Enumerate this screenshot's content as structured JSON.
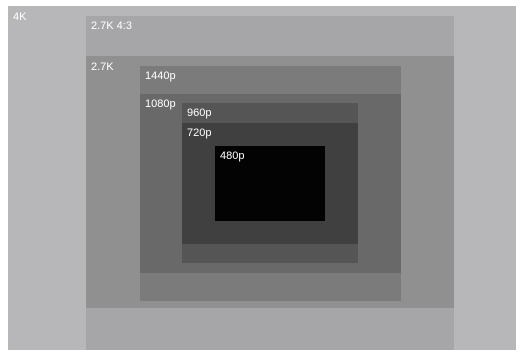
{
  "resolutions": [
    {
      "id": "4k",
      "label": "4K",
      "color": "#b7b7b9"
    },
    {
      "id": "2-7k-43",
      "label": "2.7K 4:3",
      "color": "#a6a6a8"
    },
    {
      "id": "2-7k",
      "label": "2.7K",
      "color": "#909091"
    },
    {
      "id": "1440p",
      "label": "1440p",
      "color": "#7b7b7c"
    },
    {
      "id": "1080p",
      "label": "1080p",
      "color": "#69696a"
    },
    {
      "id": "960p",
      "label": "960p",
      "color": "#555556"
    },
    {
      "id": "720p",
      "label": "720p",
      "color": "#404041"
    },
    {
      "id": "480p",
      "label": "480p",
      "color": "#030303"
    }
  ]
}
